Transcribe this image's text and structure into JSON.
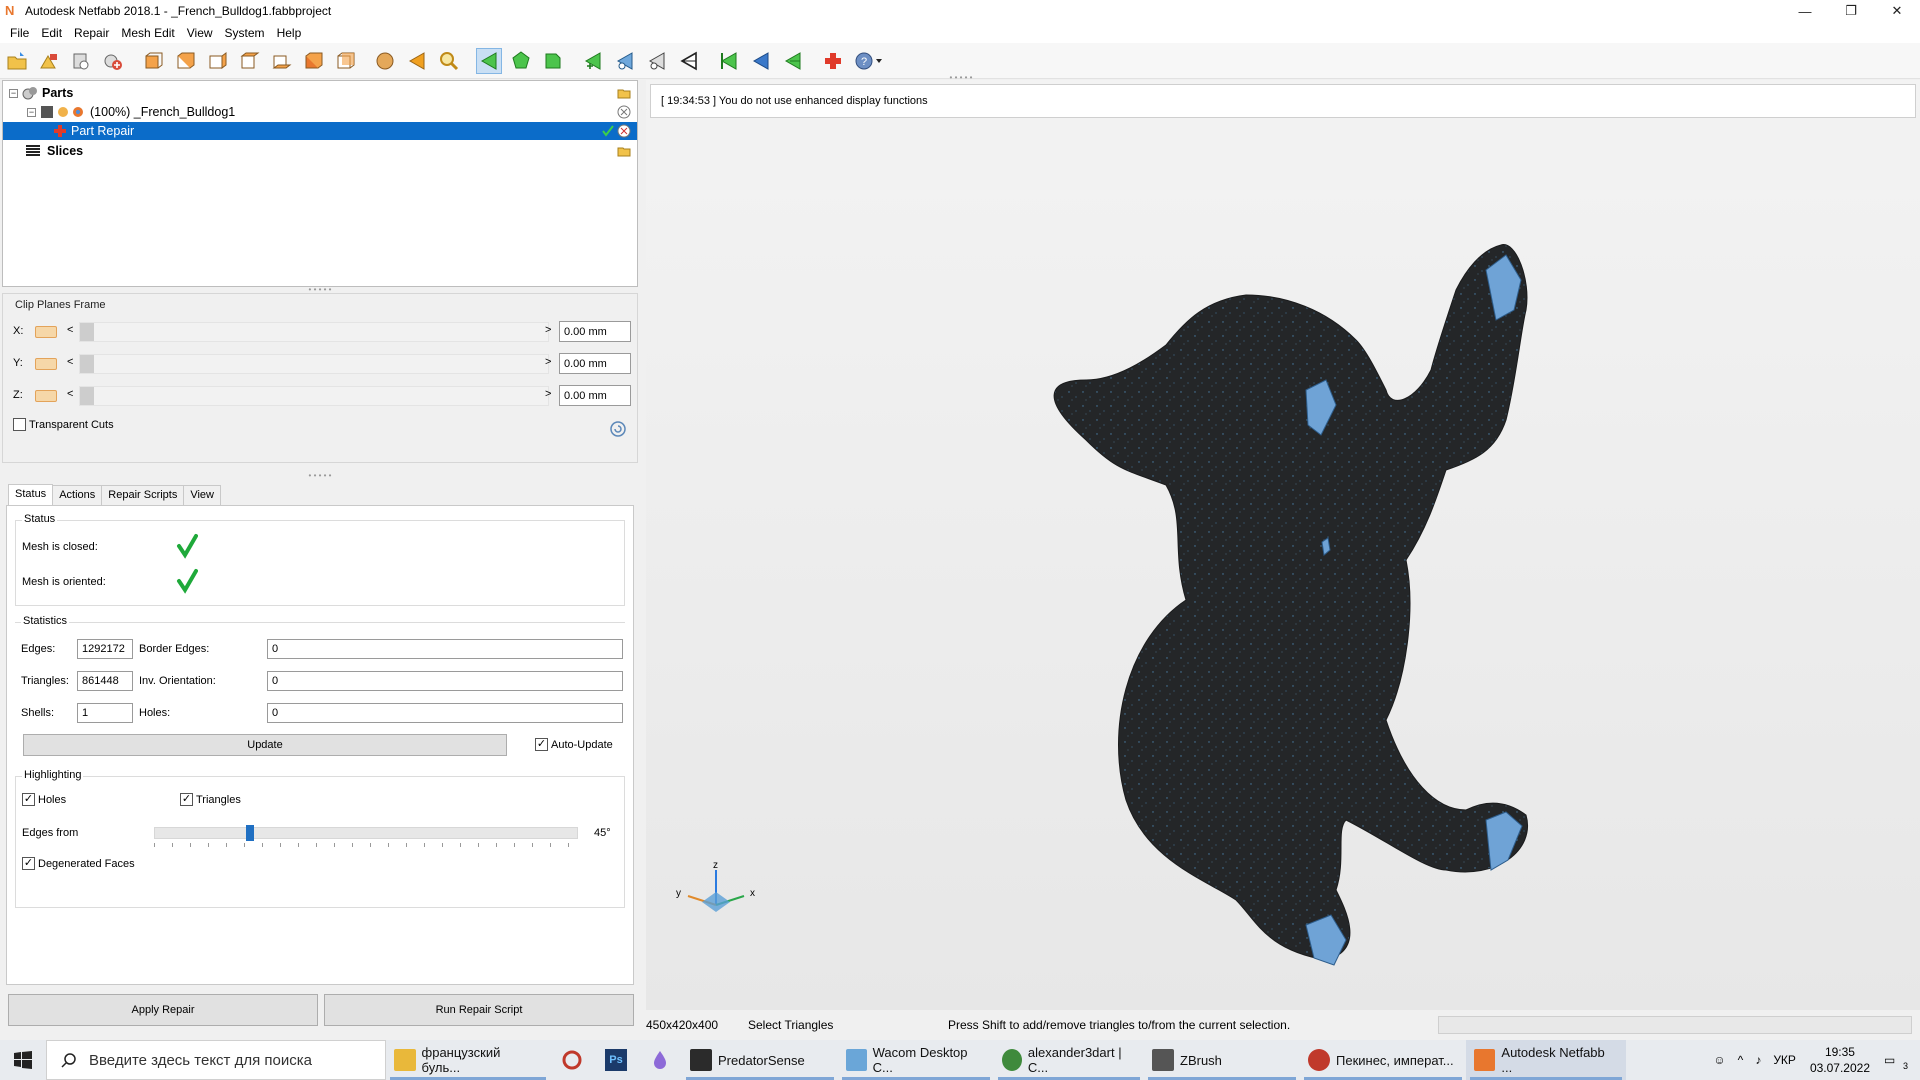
{
  "window": {
    "title": "Autodesk Netfabb 2018.1 - _French_Bulldog1.fabbproject",
    "app_icon": "N",
    "buttons": [
      "—",
      "❐",
      "✕"
    ]
  },
  "menu": [
    "File",
    "Edit",
    "Repair",
    "Mesh Edit",
    "View",
    "System",
    "Help"
  ],
  "tree": {
    "parts_label": "Parts",
    "part_label": "(100%) _French_Bulldog1",
    "repair_label": "Part Repair",
    "slices_label": "Slices"
  },
  "clip": {
    "title": "Clip Planes Frame",
    "axes": [
      {
        "axis": "X:",
        "value": "0.00 mm"
      },
      {
        "axis": "Y:",
        "value": "0.00 mm"
      },
      {
        "axis": "Z:",
        "value": "0.00 mm"
      }
    ],
    "left_arrow": "<",
    "right_arrow": ">",
    "transparent_cuts": "Transparent Cuts"
  },
  "tabs": [
    "Status",
    "Actions",
    "Repair Scripts",
    "View"
  ],
  "status_group": {
    "title": "Status",
    "mesh_closed": "Mesh is closed:",
    "mesh_oriented": "Mesh is oriented:"
  },
  "statistics": {
    "title": "Statistics",
    "edges_label": "Edges:",
    "edges": "1292172",
    "border_edges_label": "Border Edges:",
    "border_edges": "0",
    "triangles_label": "Triangles:",
    "triangles": "861448",
    "inv_orientation_label": "Inv. Orientation:",
    "inv_orientation": "0",
    "shells_label": "Shells:",
    "shells": "1",
    "holes_label": "Holes:",
    "holes": "0",
    "update_label": "Update",
    "auto_update_label": "Auto-Update"
  },
  "highlighting": {
    "title": "Highlighting",
    "holes": "Holes",
    "triangles": "Triangles",
    "edges_from": "Edges from",
    "edges_value": "45°",
    "edges_slider_fraction": 0.22,
    "degenerated": "Degenerated Faces"
  },
  "buttons": {
    "apply_repair": "Apply Repair",
    "run_script": "Run Repair Script"
  },
  "log": "[ 19:34:53 ] You do not use enhanced display functions",
  "axes": {
    "z": "z",
    "y": "y",
    "x": "x"
  },
  "statusbar": {
    "dims": "450x420x400",
    "mode": "Select Triangles",
    "hint": "Press Shift to add/remove triangles to/from the current selection."
  },
  "taskbar": {
    "search_placeholder": "Введите здесь текст для поиска",
    "items": [
      {
        "label": "французский буль...",
        "icon": "folder-icon",
        "color": "#e9b83a"
      },
      {
        "label": "PredatorSense",
        "icon": "predator-icon",
        "color": "#2b2b2b"
      },
      {
        "label": "Wacom Desktop C...",
        "icon": "wacom-icon",
        "color": "#6aa6d8"
      },
      {
        "label": "alexander3dart | C...",
        "icon": "chrome-icon",
        "color": "#3f8a3c"
      },
      {
        "label": "ZBrush",
        "icon": "zbrush-icon",
        "color": "#555555"
      },
      {
        "label": "Пекинес, императ...",
        "icon": "chrome-icon",
        "color": "#c0392b"
      },
      {
        "label": "Autodesk Netfabb ...",
        "icon": "netfabb-icon",
        "color": "#e8772e"
      }
    ],
    "lang": "УКР",
    "time": "19:35",
    "date": "03.07.2022",
    "notif_count": "3"
  }
}
